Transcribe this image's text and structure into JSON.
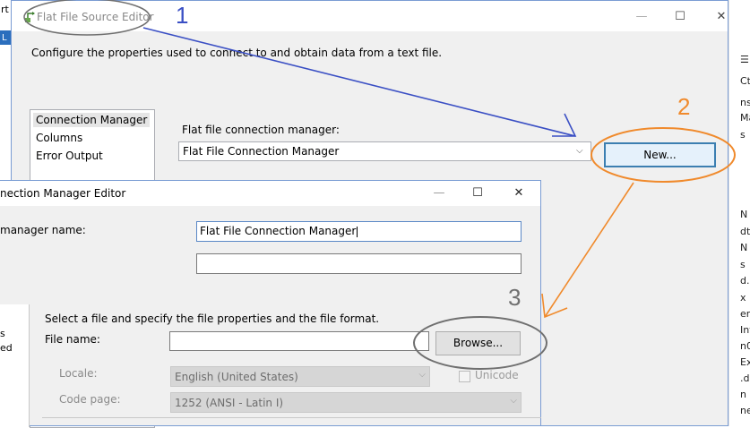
{
  "background": {
    "left_fragments": [
      "rt",
      "L"
    ],
    "right_fragments": [
      "☰",
      "Ct",
      "ns",
      "Ma",
      "s",
      "N",
      "dt",
      "N",
      "s",
      "d.c",
      "x",
      "er.",
      "Int",
      "n0",
      "Ex",
      ".d",
      "n",
      "ne"
    ]
  },
  "outer_dialog": {
    "title": "Flat File Source Editor",
    "minimize_glyph": "—",
    "maximize_glyph": "☐",
    "close_glyph": "✕",
    "description": "Configure the properties used to connect to and obtain data from a text file.",
    "nav_items": [
      "Connection Manager",
      "Columns",
      "Error Output"
    ],
    "conn_manager_label": "Flat file connection manager:",
    "conn_manager_value": "Flat File Connection Manager",
    "new_button": "New..."
  },
  "inner_dialog": {
    "title": "nection Manager Editor",
    "manager_name_label": "manager name:",
    "manager_name_value": "Flat File Connection Manager",
    "description_value": "",
    "left_fragments": [
      "s",
      "ed"
    ],
    "select_text": "Select a file and specify the file properties and the file format.",
    "file_name_label": "File name:",
    "file_name_value": "",
    "browse_button": "Browse...",
    "locale_label": "Locale:",
    "locale_value": "English (United States)",
    "unicode_label": "Unicode",
    "code_page_label": "Code page:",
    "code_page_value": "1252  (ANSI - Latin I)"
  },
  "annotations": {
    "labels": [
      "1",
      "2",
      "3"
    ],
    "colors": {
      "blue": "#3a4fc4",
      "orange": "#f08a2c",
      "gray": "#707070"
    }
  }
}
